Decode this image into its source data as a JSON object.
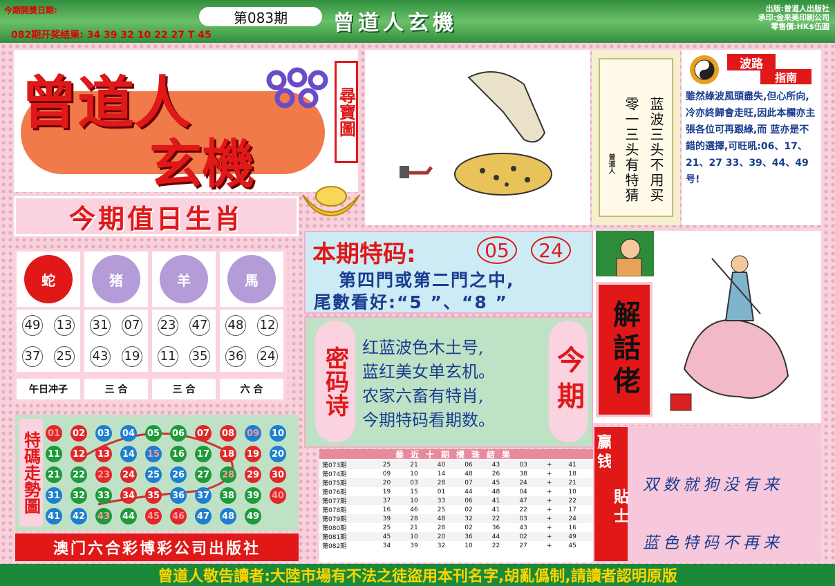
{
  "header": {
    "date_label": "今期開獎日期:",
    "issue": "第083期",
    "last_result": "082期开奖结果:  34 39 32 10 22 27 T 45",
    "banner_title": "曾道人玄機",
    "publisher_lines": [
      "出版:曾道人出版社",
      "承印:金來美印刷公司",
      "零售價:HK$伍圓"
    ]
  },
  "logo": {
    "line1": "曾道人",
    "line2": "玄機",
    "side": "尋寶圖"
  },
  "zodiac": {
    "heading": "今期值日生肖",
    "animals": [
      {
        "name": "蛇",
        "nums": [
          "49",
          "13",
          "37",
          "25"
        ],
        "tag": "午日冲子"
      },
      {
        "name": "猪",
        "nums": [
          "31",
          "07",
          "43",
          "19"
        ],
        "tag": "三  合"
      },
      {
        "name": "羊",
        "nums": [
          "23",
          "47",
          "11",
          "35"
        ],
        "tag": "三  合"
      },
      {
        "name": "馬",
        "nums": [
          "48",
          "12",
          "36",
          "24"
        ],
        "tag": "六  合"
      }
    ]
  },
  "poem_box": {
    "col1": "蓝波三头不用买",
    "col2": "零一三头有特猜",
    "seal": "曾道人"
  },
  "guide": {
    "title1": "波路",
    "title2": "指南",
    "text": "雖然綠波風頭盡失,但心所向,冷亦終歸會走旺,因此本欄亦主張各位可再跟綠,而 蓝亦是不錯的選擇,可旺吼:06、17、21、27 33、39、44、49号!"
  },
  "special": {
    "label": "本期特码:",
    "codes": [
      "05",
      "24"
    ],
    "line2": "第四門或第二門之中,",
    "line3": "尾數看好:“5 ”、“8 ”"
  },
  "mima": {
    "left": "密码诗",
    "right": "今期",
    "lines": [
      "红蓝波色木土号,",
      "蓝红美女单玄机。",
      "农家六畜有特肖,",
      "今期特码看期数。"
    ]
  },
  "jiehua": {
    "label": "解話佬"
  },
  "tip": {
    "left": "赢钱",
    "right": "貼士",
    "line1": "双数就狗没有来",
    "line2": "蓝色特码不再来"
  },
  "trend": {
    "label": "特碼走勢圖"
  },
  "footer_company": "澳门六合彩博彩公司出版社",
  "results": {
    "title": "最近十期攪珠結果",
    "rows": [
      [
        "第073期",
        "25",
        "21",
        "40",
        "06",
        "43",
        "03",
        "+",
        "41"
      ],
      [
        "第074期",
        "09",
        "10",
        "14",
        "48",
        "26",
        "38",
        "+",
        "18"
      ],
      [
        "第075期",
        "20",
        "03",
        "28",
        "07",
        "45",
        "24",
        "+",
        "21"
      ],
      [
        "第076期",
        "19",
        "15",
        "01",
        "44",
        "48",
        "04",
        "+",
        "10"
      ],
      [
        "第077期",
        "37",
        "10",
        "33",
        "06",
        "41",
        "47",
        "+",
        "22"
      ],
      [
        "第078期",
        "16",
        "46",
        "25",
        "02",
        "41",
        "22",
        "+",
        "17"
      ],
      [
        "第079期",
        "39",
        "28",
        "48",
        "32",
        "22",
        "03",
        "+",
        "24"
      ],
      [
        "第080期",
        "25",
        "21",
        "28",
        "02",
        "36",
        "43",
        "+",
        "16"
      ],
      [
        "第081期",
        "45",
        "10",
        "20",
        "36",
        "44",
        "02",
        "+",
        "49"
      ],
      [
        "第082期",
        "34",
        "39",
        "32",
        "10",
        "22",
        "27",
        "+",
        "45"
      ]
    ]
  },
  "bottom_banner": "曾道人敬告讀者:大陸市場有不法之徒盜用本刊名字,胡亂僞制,請讀者認明原版",
  "colors": {
    "red": "#e02828",
    "blue": "#1d7fd0",
    "green": "#1f9a3a"
  },
  "balls": [
    [
      "01",
      "r"
    ],
    [
      "02",
      "r"
    ],
    [
      "03",
      "b"
    ],
    [
      "04",
      "b"
    ],
    [
      "05",
      "g"
    ],
    [
      "06",
      "g"
    ],
    [
      "07",
      "r"
    ],
    [
      "08",
      "r"
    ],
    [
      "09",
      "b"
    ],
    [
      "10",
      "b"
    ],
    [
      "11",
      "g"
    ],
    [
      "12",
      "r"
    ],
    [
      "13",
      "r"
    ],
    [
      "14",
      "b"
    ],
    [
      "15",
      "b"
    ],
    [
      "16",
      "g"
    ],
    [
      "17",
      "g"
    ],
    [
      "18",
      "r"
    ],
    [
      "19",
      "r"
    ],
    [
      "20",
      "b"
    ],
    [
      "21",
      "g"
    ],
    [
      "22",
      "g"
    ],
    [
      "23",
      "r"
    ],
    [
      "24",
      "r"
    ],
    [
      "25",
      "b"
    ],
    [
      "26",
      "b"
    ],
    [
      "27",
      "g"
    ],
    [
      "28",
      "g"
    ],
    [
      "29",
      "r"
    ],
    [
      "30",
      "r"
    ],
    [
      "31",
      "b"
    ],
    [
      "32",
      "g"
    ],
    [
      "33",
      "g"
    ],
    [
      "34",
      "r"
    ],
    [
      "35",
      "r"
    ],
    [
      "36",
      "b"
    ],
    [
      "37",
      "b"
    ],
    [
      "38",
      "g"
    ],
    [
      "39",
      "g"
    ],
    [
      "40",
      "r"
    ],
    [
      "41",
      "b"
    ],
    [
      "42",
      "b"
    ],
    [
      "43",
      "g"
    ],
    [
      "44",
      "g"
    ],
    [
      "45",
      "r"
    ],
    [
      "46",
      "r"
    ],
    [
      "47",
      "b"
    ],
    [
      "48",
      "b"
    ],
    [
      "49",
      "g"
    ]
  ],
  "ball_hot": [
    "01",
    "09",
    "15",
    "23",
    "28",
    "40",
    "43",
    "45",
    "46"
  ]
}
